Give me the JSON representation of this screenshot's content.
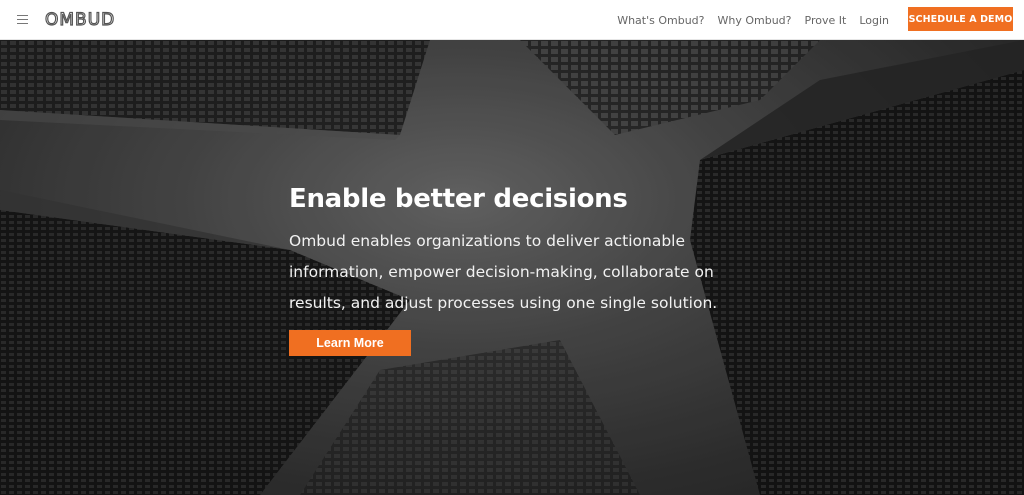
{
  "brand": {
    "logo_text": "OMBUD"
  },
  "nav": {
    "items": [
      {
        "label": "What's Ombud?"
      },
      {
        "label": "Why Ombud?"
      },
      {
        "label": "Prove It"
      },
      {
        "label": "Login"
      }
    ],
    "cta_label": "SCHEDULE A DEMO"
  },
  "hero": {
    "title": "Enable better decisions",
    "text": "Ombud enables organizations to deliver actionable information, empower decision-making, collaborate on results, and adjust processes using one single solution.",
    "button_label": "Learn More"
  },
  "icons": {
    "menu": "hamburger-icon"
  },
  "colors": {
    "accent": "#f06f21",
    "header_bg": "#ffffff",
    "nav_text": "#666666",
    "hero_text": "#ffffff"
  }
}
